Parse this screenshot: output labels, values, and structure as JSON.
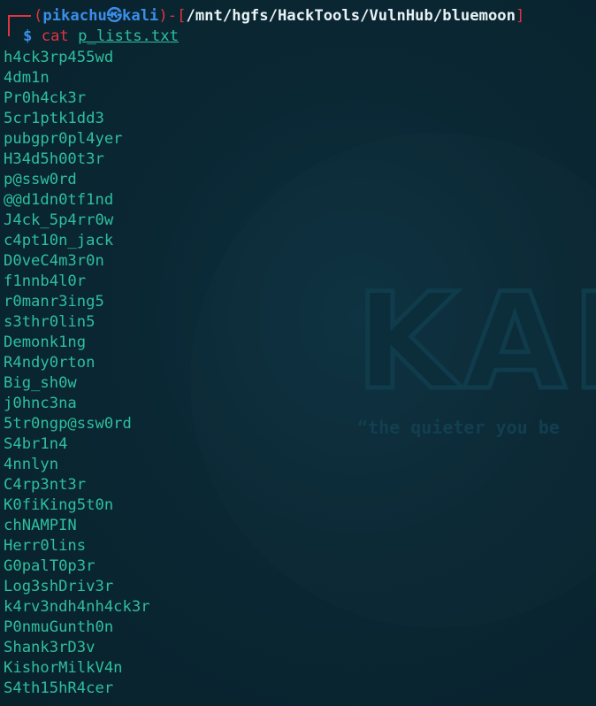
{
  "prompt": {
    "user": "pikachu",
    "at_symbol": "㉿",
    "host": "kali",
    "path": "/mnt/hgfs/HackTools/VulnHub/bluemoon",
    "dollar": "$",
    "command": "cat",
    "argument": "p_lists.txt",
    "open_paren": "(",
    "close_paren": ")",
    "dash": "-",
    "open_bracket": "[",
    "close_bracket": "]"
  },
  "output_lines": [
    "h4ck3rp455wd",
    "4dm1n",
    "Pr0h4ck3r",
    "5cr1ptk1dd3",
    "pubgpr0pl4yer",
    "H34d5h00t3r",
    "p@ssw0rd",
    "@@d1dn0tf1nd",
    "J4ck_5p4rr0w",
    "c4pt10n_jack",
    "D0veC4m3r0n",
    "f1nnb4l0r",
    "r0manr3ing5",
    "s3thr0lin5",
    "Demonk1ng",
    "R4ndy0rton",
    "Big_sh0w",
    "j0hnc3na",
    "5tr0ngp@ssw0rd",
    "S4br1n4",
    "4nnlyn",
    "C4rp3nt3r",
    "K0fiKing5t0n",
    "chNAMPIN",
    "Herr0lins",
    "G0palT0p3r",
    "Log3shDriv3r",
    "k4rv3ndh4nh4ck3r",
    "P0nmuGunth0n",
    "Shank3rD3v",
    "KishorMilkV4n",
    "S4th15hR4cer"
  ],
  "watermark": {
    "word": "KAL",
    "tagline": "“the quieter you be"
  },
  "colors": {
    "background": "#0a2733",
    "accent_red": "#e0343f",
    "accent_blue": "#3b8eea",
    "output_green": "#2fbf9f",
    "path_white": "#e8f2f5"
  }
}
